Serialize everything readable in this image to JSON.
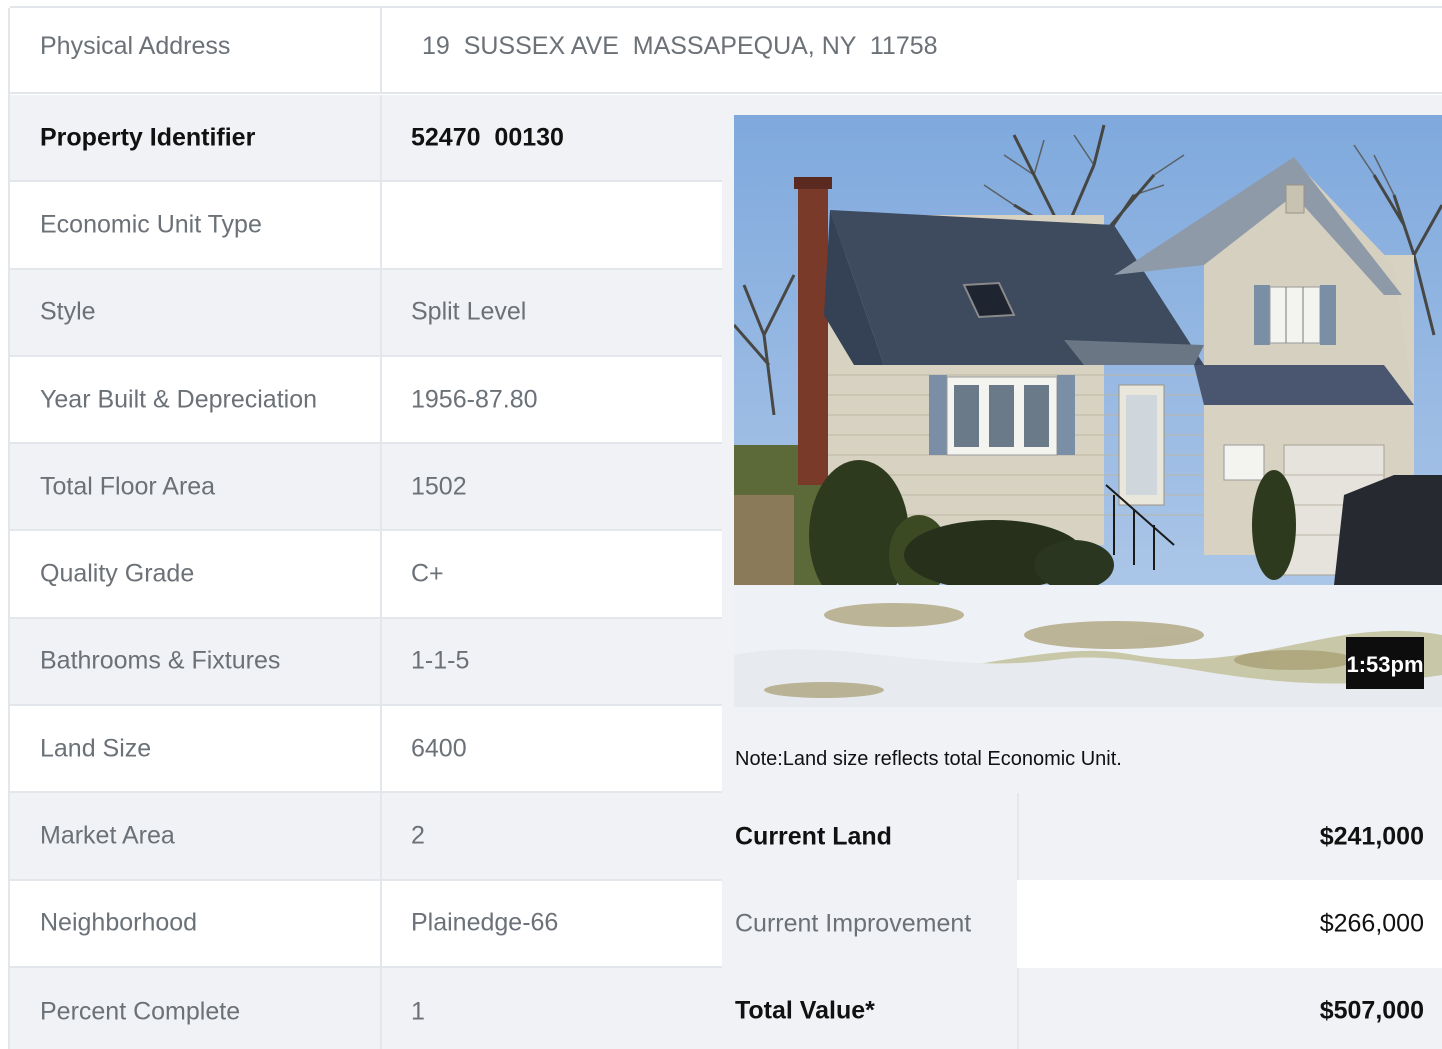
{
  "physical_address": {
    "label": "Physical Address",
    "value": "19  SUSSEX AVE  MASSAPEQUA, NY  11758"
  },
  "property_rows": [
    {
      "label": "Property Identifier",
      "value": "52470  00130",
      "bold": true
    },
    {
      "label": "Economic Unit Type",
      "value": ""
    },
    {
      "label": "Style",
      "value": "Split Level"
    },
    {
      "label": "Year Built & Depreciation",
      "value": "1956-87.80"
    },
    {
      "label": "Total Floor Area",
      "value": "1502"
    },
    {
      "label": "Quality Grade",
      "value": "C+"
    },
    {
      "label": "Bathrooms & Fixtures",
      "value": "1-1-5"
    },
    {
      "label": "Land Size",
      "value": "6400"
    },
    {
      "label": "Market Area",
      "value": "2"
    },
    {
      "label": "Neighborhood",
      "value": "Plainedge-66"
    },
    {
      "label": "Percent Complete",
      "value": "1"
    }
  ],
  "photo": {
    "timestamp": "1:53pm"
  },
  "note": "Note:Land size reflects total Economic Unit.",
  "valuation": [
    {
      "label": "Current Land",
      "amount": "$241,000",
      "bold": true
    },
    {
      "label": "Current Improvement",
      "amount": "$266,000",
      "bold": false
    },
    {
      "label": "Total Value*",
      "amount": "$507,000",
      "bold": true
    }
  ]
}
